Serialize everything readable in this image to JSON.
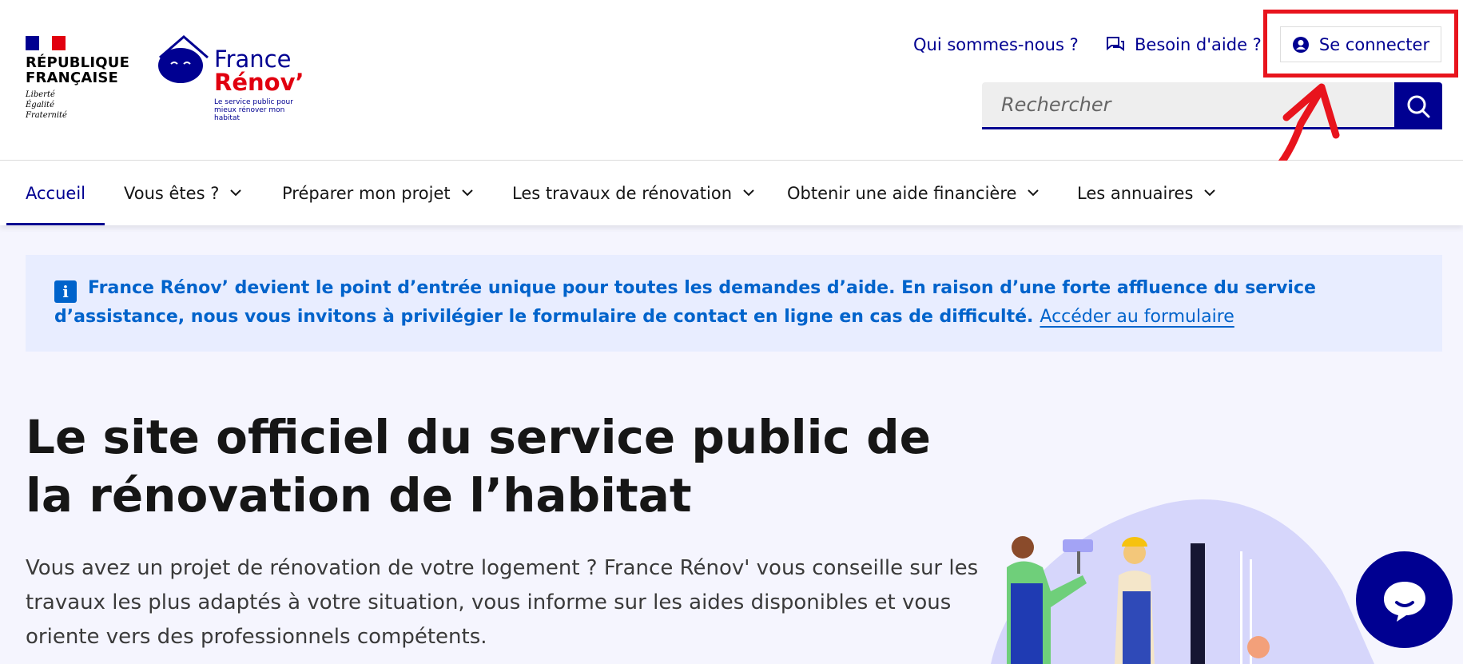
{
  "header": {
    "republic": {
      "line1": "RÉPUBLIQUE",
      "line2": "FRANÇAISE",
      "motto1": "Liberté",
      "motto2": "Égalité",
      "motto3": "Fraternité"
    },
    "brand": {
      "line1": "France",
      "line2": "Rénov’",
      "tagline": "Le service public pour mieux rénover mon habitat"
    },
    "links": {
      "about": "Qui sommes-nous ?",
      "help": "Besoin d'aide ?",
      "login": "Se connecter"
    },
    "search": {
      "placeholder": "Rechercher"
    }
  },
  "nav": {
    "items": [
      {
        "label": "Accueil"
      },
      {
        "label": "Vous êtes ?"
      },
      {
        "label": "Préparer mon projet"
      },
      {
        "label": "Les travaux de rénovation"
      },
      {
        "label": "Obtenir une aide financière"
      },
      {
        "label": "Les annuaires"
      }
    ]
  },
  "notice": {
    "text": "France Rénov’ devient le point d’entrée unique pour toutes les demandes d’aide. En raison d’une forte affluence du service d’assistance, nous vous invitons à privilégier le formulaire de contact en ligne en cas de difficulté.",
    "link": "Accéder au formulaire"
  },
  "hero": {
    "title": "Le site officiel du service public de la rénovation de l’habitat",
    "text": "Vous avez un projet de rénovation de votre logement ? France Rénov' vous conseille sur les travaux les plus adaptés à votre situation, vous informe sur les aides disponibles et vous oriente vers des professionnels compétents."
  },
  "colors": {
    "primary": "#000091",
    "accent_red": "#e1000f",
    "info": "#0063cb",
    "annotation": "#e8141d"
  }
}
